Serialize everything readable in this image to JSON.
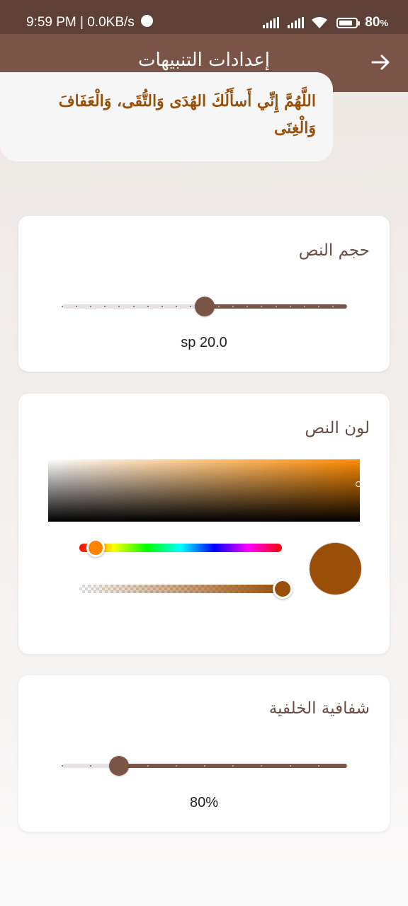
{
  "status_bar": {
    "time_speed": "9:59 PM | 0.0KB/s",
    "battery": "80",
    "battery_unit": "%",
    "battery_level": 0.8
  },
  "app_bar": {
    "title": "إعدادات التنبيهات",
    "back_icon": "arrow-right-icon"
  },
  "dua": {
    "text": "اللَّهُمَّ إِنِّي أَسأَلُكَ الهُدَى وَالتُّقَى، وَالْعَفَافَ وَالْغِنَى"
  },
  "text_size": {
    "title": "حجم النص",
    "value_label": "sp 20.0",
    "value": 20.0,
    "min": 10,
    "max": 30,
    "divisions": 20
  },
  "text_color": {
    "title": "لون النص",
    "selected_color": "#9a4f08",
    "hue_color": "#ff8300"
  },
  "background_opacity": {
    "title": "شفافية الخلفية",
    "value_label": "80%",
    "value": 0.8,
    "min": 0.6,
    "max": 1.6,
    "divisions": 10
  },
  "colors": {
    "primary": "#7a5446",
    "status_bar": "#5e4036",
    "dua_text": "#9a4f08"
  }
}
